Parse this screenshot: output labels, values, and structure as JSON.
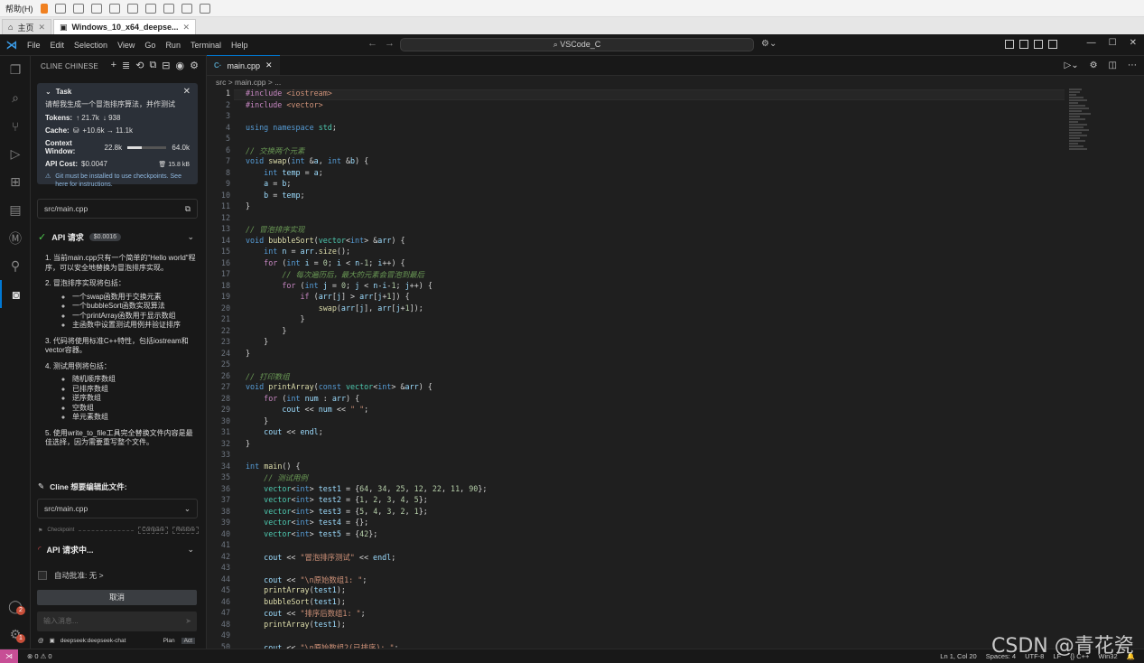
{
  "vm_toolbar": {
    "help": "帮助(H)"
  },
  "vm_tabs": [
    {
      "label": "主页"
    },
    {
      "label": "Windows_10_x64_deepse..."
    }
  ],
  "menu": [
    "File",
    "Edit",
    "Selection",
    "View",
    "Go",
    "Run",
    "Terminal",
    "Help"
  ],
  "command_center": "VSCode_C",
  "sidebar": {
    "title": "CLINE CHINESE",
    "task": {
      "label": "Task",
      "description": "请帮我生成一个冒泡排序算法，并作测试",
      "tokens_label": "Tokens:",
      "tokens_in": "↑ 21.7k",
      "tokens_out": "↓ 938",
      "cache_label": "Cache:",
      "cache_value": "+10.6k → 11.1k",
      "context_label": "Context Window:",
      "context_used": "22.8k",
      "context_max": "64.0k",
      "context_fraction": 0.356,
      "api_cost_label": "API Cost:",
      "api_cost": "$0.0047",
      "size": "15.8 kB",
      "warning": "Git must be installed to use checkpoints. See here for instructions."
    },
    "file1": "src/main.cpp",
    "api_request": {
      "label": "API 请求",
      "cost": "$0.0016"
    },
    "items": [
      "1. 当前main.cpp只有一个简单的\"Hello world\"程序，可以安全地替换为冒泡排序实现。",
      "2. 冒泡排序实现将包括：",
      "3. 代码将使用标准C++特性，包括iostream和vector容器。",
      "4. 测试用例将包括：",
      "5. 使用write_to_file工具完全替换文件内容是最佳选择，因为需要重写整个文件。"
    ],
    "sub2": [
      "一个swap函数用于交换元素",
      "一个bubbleSort函数实现算法",
      "一个printArray函数用于显示数组",
      "主函数中设置测试用例并验证排序"
    ],
    "sub4": [
      "随机顺序数组",
      "已排序数组",
      "逆序数组",
      "空数组",
      "单元素数组"
    ],
    "edit_label": "Cline 想要编辑此文件:",
    "file2": "src/main.cpp",
    "checkpoint": "Checkpoint",
    "compare": "Compare",
    "restore": "Restore",
    "api_loading": "API 请求中...",
    "auto_approve": "自动批准: 无 >",
    "cancel": "取消",
    "input_placeholder": "输入消息...",
    "model": "deepseek:deepseek-chat",
    "plan": "Plan",
    "act": "Act"
  },
  "editor": {
    "tab": "main.cpp",
    "breadcrumb": "src > main.cpp > ...",
    "line_numbers": [
      "1",
      "2",
      "3",
      "4",
      "5",
      "6",
      "7",
      "8",
      "9",
      "10",
      "11",
      "12",
      "13",
      "14",
      "15",
      "16",
      "17",
      "18",
      "19",
      "20",
      "21",
      "22",
      "23",
      "24",
      "25",
      "26",
      "27",
      "28",
      "29",
      "30",
      "31",
      "32",
      "33",
      "34",
      "35",
      "36",
      "37",
      "38",
      "39",
      "40",
      "41",
      "42",
      "43",
      "44",
      "45",
      "46",
      "47",
      "48",
      "49",
      "50"
    ]
  },
  "status": {
    "problems": "⊗ 0 ⚠ 0",
    "position": "Ln 1, Col 20",
    "spaces": "Spaces: 4",
    "encoding": "UTF-8",
    "eol": "LF",
    "language": "{} C++",
    "platform": "Win32"
  },
  "watermark": "CSDN @青花瓷",
  "colors": {
    "accent": "#0078d4",
    "remote": "#c74e95",
    "check": "#4ec94e"
  }
}
